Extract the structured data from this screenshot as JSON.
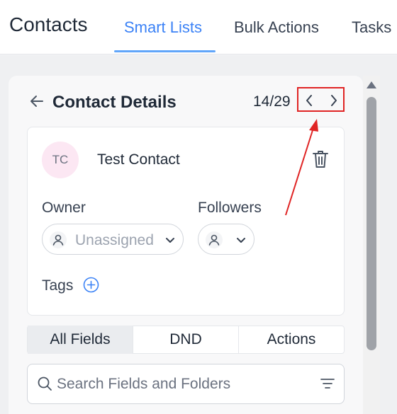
{
  "header": {
    "app_title": "Contacts",
    "tabs": [
      {
        "label": "Smart Lists",
        "active": true
      },
      {
        "label": "Bulk Actions",
        "active": false
      },
      {
        "label": "Tasks",
        "active": false
      }
    ]
  },
  "panel": {
    "title": "Contact Details",
    "counter": "14/29"
  },
  "contact": {
    "initials": "TC",
    "name": "Test Contact",
    "owner_label": "Owner",
    "owner_value": "Unassigned",
    "followers_label": "Followers",
    "tags_label": "Tags"
  },
  "field_tabs": [
    {
      "label": "All Fields",
      "active": true
    },
    {
      "label": "DND",
      "active": false
    },
    {
      "label": "Actions",
      "active": false
    }
  ],
  "search": {
    "placeholder": "Search Fields and Folders"
  },
  "colors": {
    "accent": "#3b82f6",
    "annotation": "#e02424",
    "avatar_bg": "#fce7f3"
  },
  "icons": [
    "back-arrow-icon",
    "chevron-left-icon",
    "chevron-right-icon",
    "trash-icon",
    "user-icon",
    "chevron-down-icon",
    "plus-circle-icon",
    "search-icon",
    "filter-icon"
  ]
}
